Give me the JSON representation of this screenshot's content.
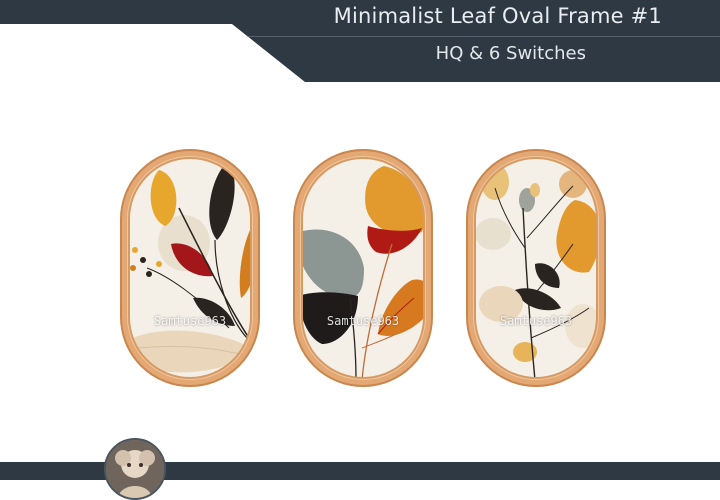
{
  "header": {
    "title": "Minimalist Leaf Oval Frame #1",
    "subtitle": "HQ & 6 Switches"
  },
  "frames": [
    {
      "watermark": "Samtuse963"
    },
    {
      "watermark": "Samtuse963"
    },
    {
      "watermark": "Samtuse963"
    }
  ],
  "colors": {
    "banner": "#2f3943",
    "frame_wood": "#e2a56f",
    "canvas": "#f4efe7"
  },
  "icons": [
    "avatar-image"
  ]
}
